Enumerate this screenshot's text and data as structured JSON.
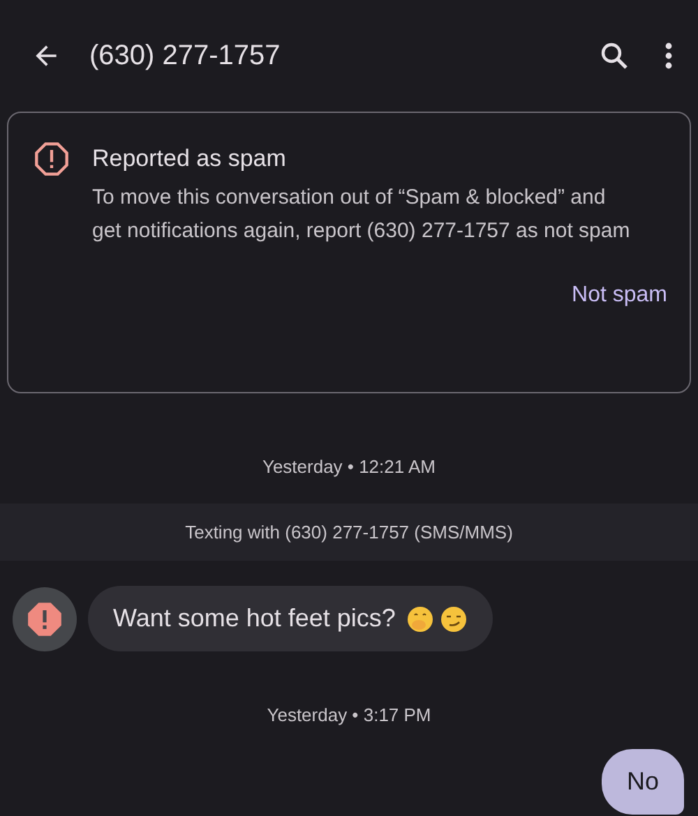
{
  "header": {
    "title": "(630) 277-1757"
  },
  "spam_card": {
    "title": "Reported as spam",
    "body": "To move this conversation out of “Spam & blocked” and get notifications again, report (630) 277-1757 as not spam",
    "action": "Not spam"
  },
  "messages": [
    {
      "kind": "timestamp",
      "text": "Yesterday • 12:21 AM"
    },
    {
      "kind": "banner",
      "text": "Texting with (630) 277-1757 (SMS/MMS)"
    },
    {
      "kind": "incoming",
      "text": "Want some hot feet pics?"
    },
    {
      "kind": "timestamp",
      "text": "Yesterday • 3:17 PM"
    },
    {
      "kind": "outgoing",
      "text": "No"
    }
  ]
}
